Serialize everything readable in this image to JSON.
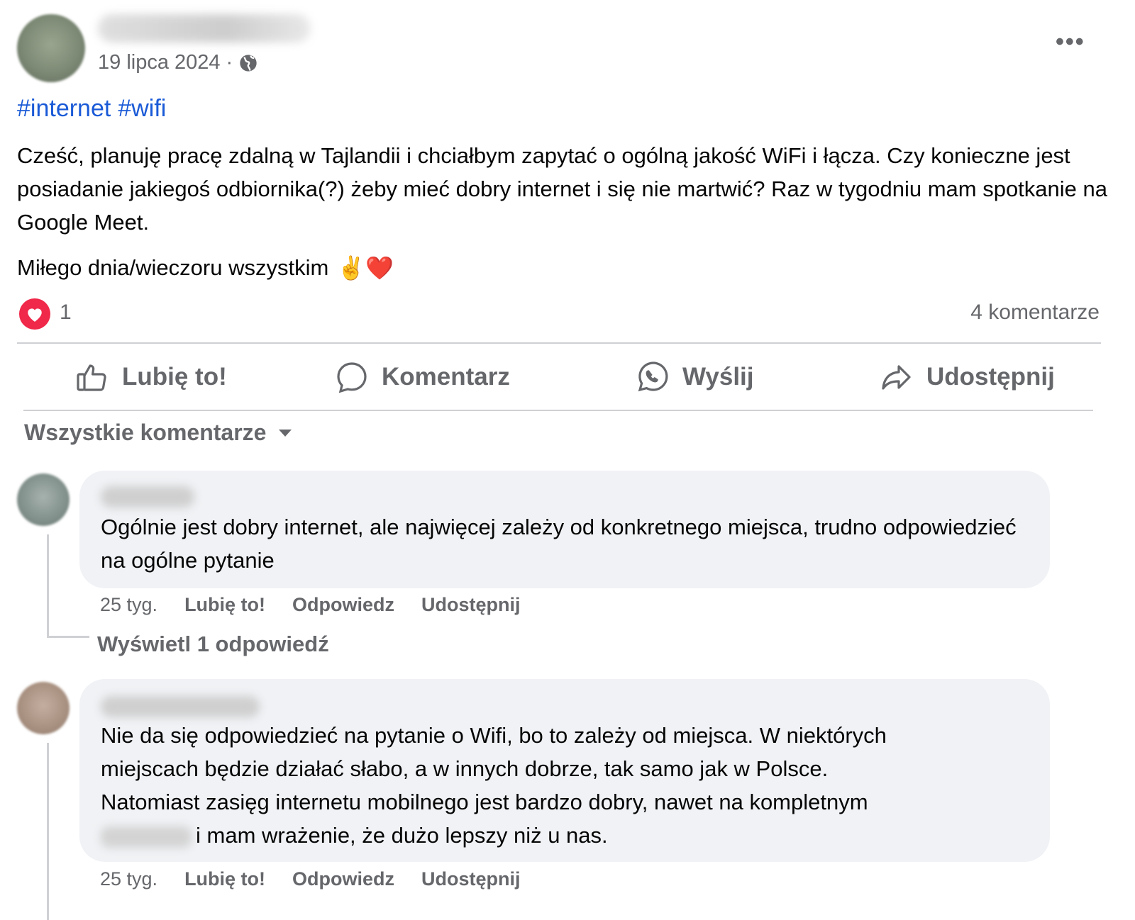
{
  "post": {
    "date": "19 lipca 2024",
    "separator": "·",
    "hashtags": [
      "#internet",
      "#wifi"
    ],
    "text": "Cześć, planuję pracę zdalną w Tajlandii i chciałbym zapytać o ogólną jakość WiFi i łącza. Czy konieczne jest posiadanie jakiegoś odbiornika(?) żeby mieć dobry internet i się nie martwić? Raz w tygodniu mam spotkanie na Google Meet.",
    "greeting": "Miłego dnia/wieczoru wszystkim",
    "greeting_emoji": "✌️❤️",
    "more": "•••"
  },
  "reactions": {
    "count": "1",
    "comments": "4 komentarze"
  },
  "actions": {
    "like": "Lubię to!",
    "comment": "Komentarz",
    "send": "Wyślij",
    "share": "Udostępnij"
  },
  "filter": {
    "label": "Wszystkie komentarze"
  },
  "comments": [
    {
      "text": "Ogólnie jest dobry internet, ale najwięcej zależy od konkretnego miejsca, trudno odpowiedzieć na ogólne pytanie",
      "age": "25 tyg.",
      "like": "Lubię to!",
      "reply": "Odpowiedz",
      "share": "Udostępnij",
      "view_replies": "Wyświetl 1 odpowiedź"
    },
    {
      "text_lines": [
        "Nie da się odpowiedzieć na pytanie o Wifi, bo to zależy od miejsca. W niektórych",
        "miejscach będzie działać słabo, a w innych dobrze, tak samo jak w Polsce.",
        "Natomiast zasięg internetu mobilnego jest bardzo dobry, nawet na kompletnym",
        "i mam wrażenie, że dużo lepszy niż u nas."
      ],
      "age": "25 tyg.",
      "like": "Lubię to!",
      "reply": "Odpowiedz",
      "share": "Udostępnij"
    }
  ]
}
